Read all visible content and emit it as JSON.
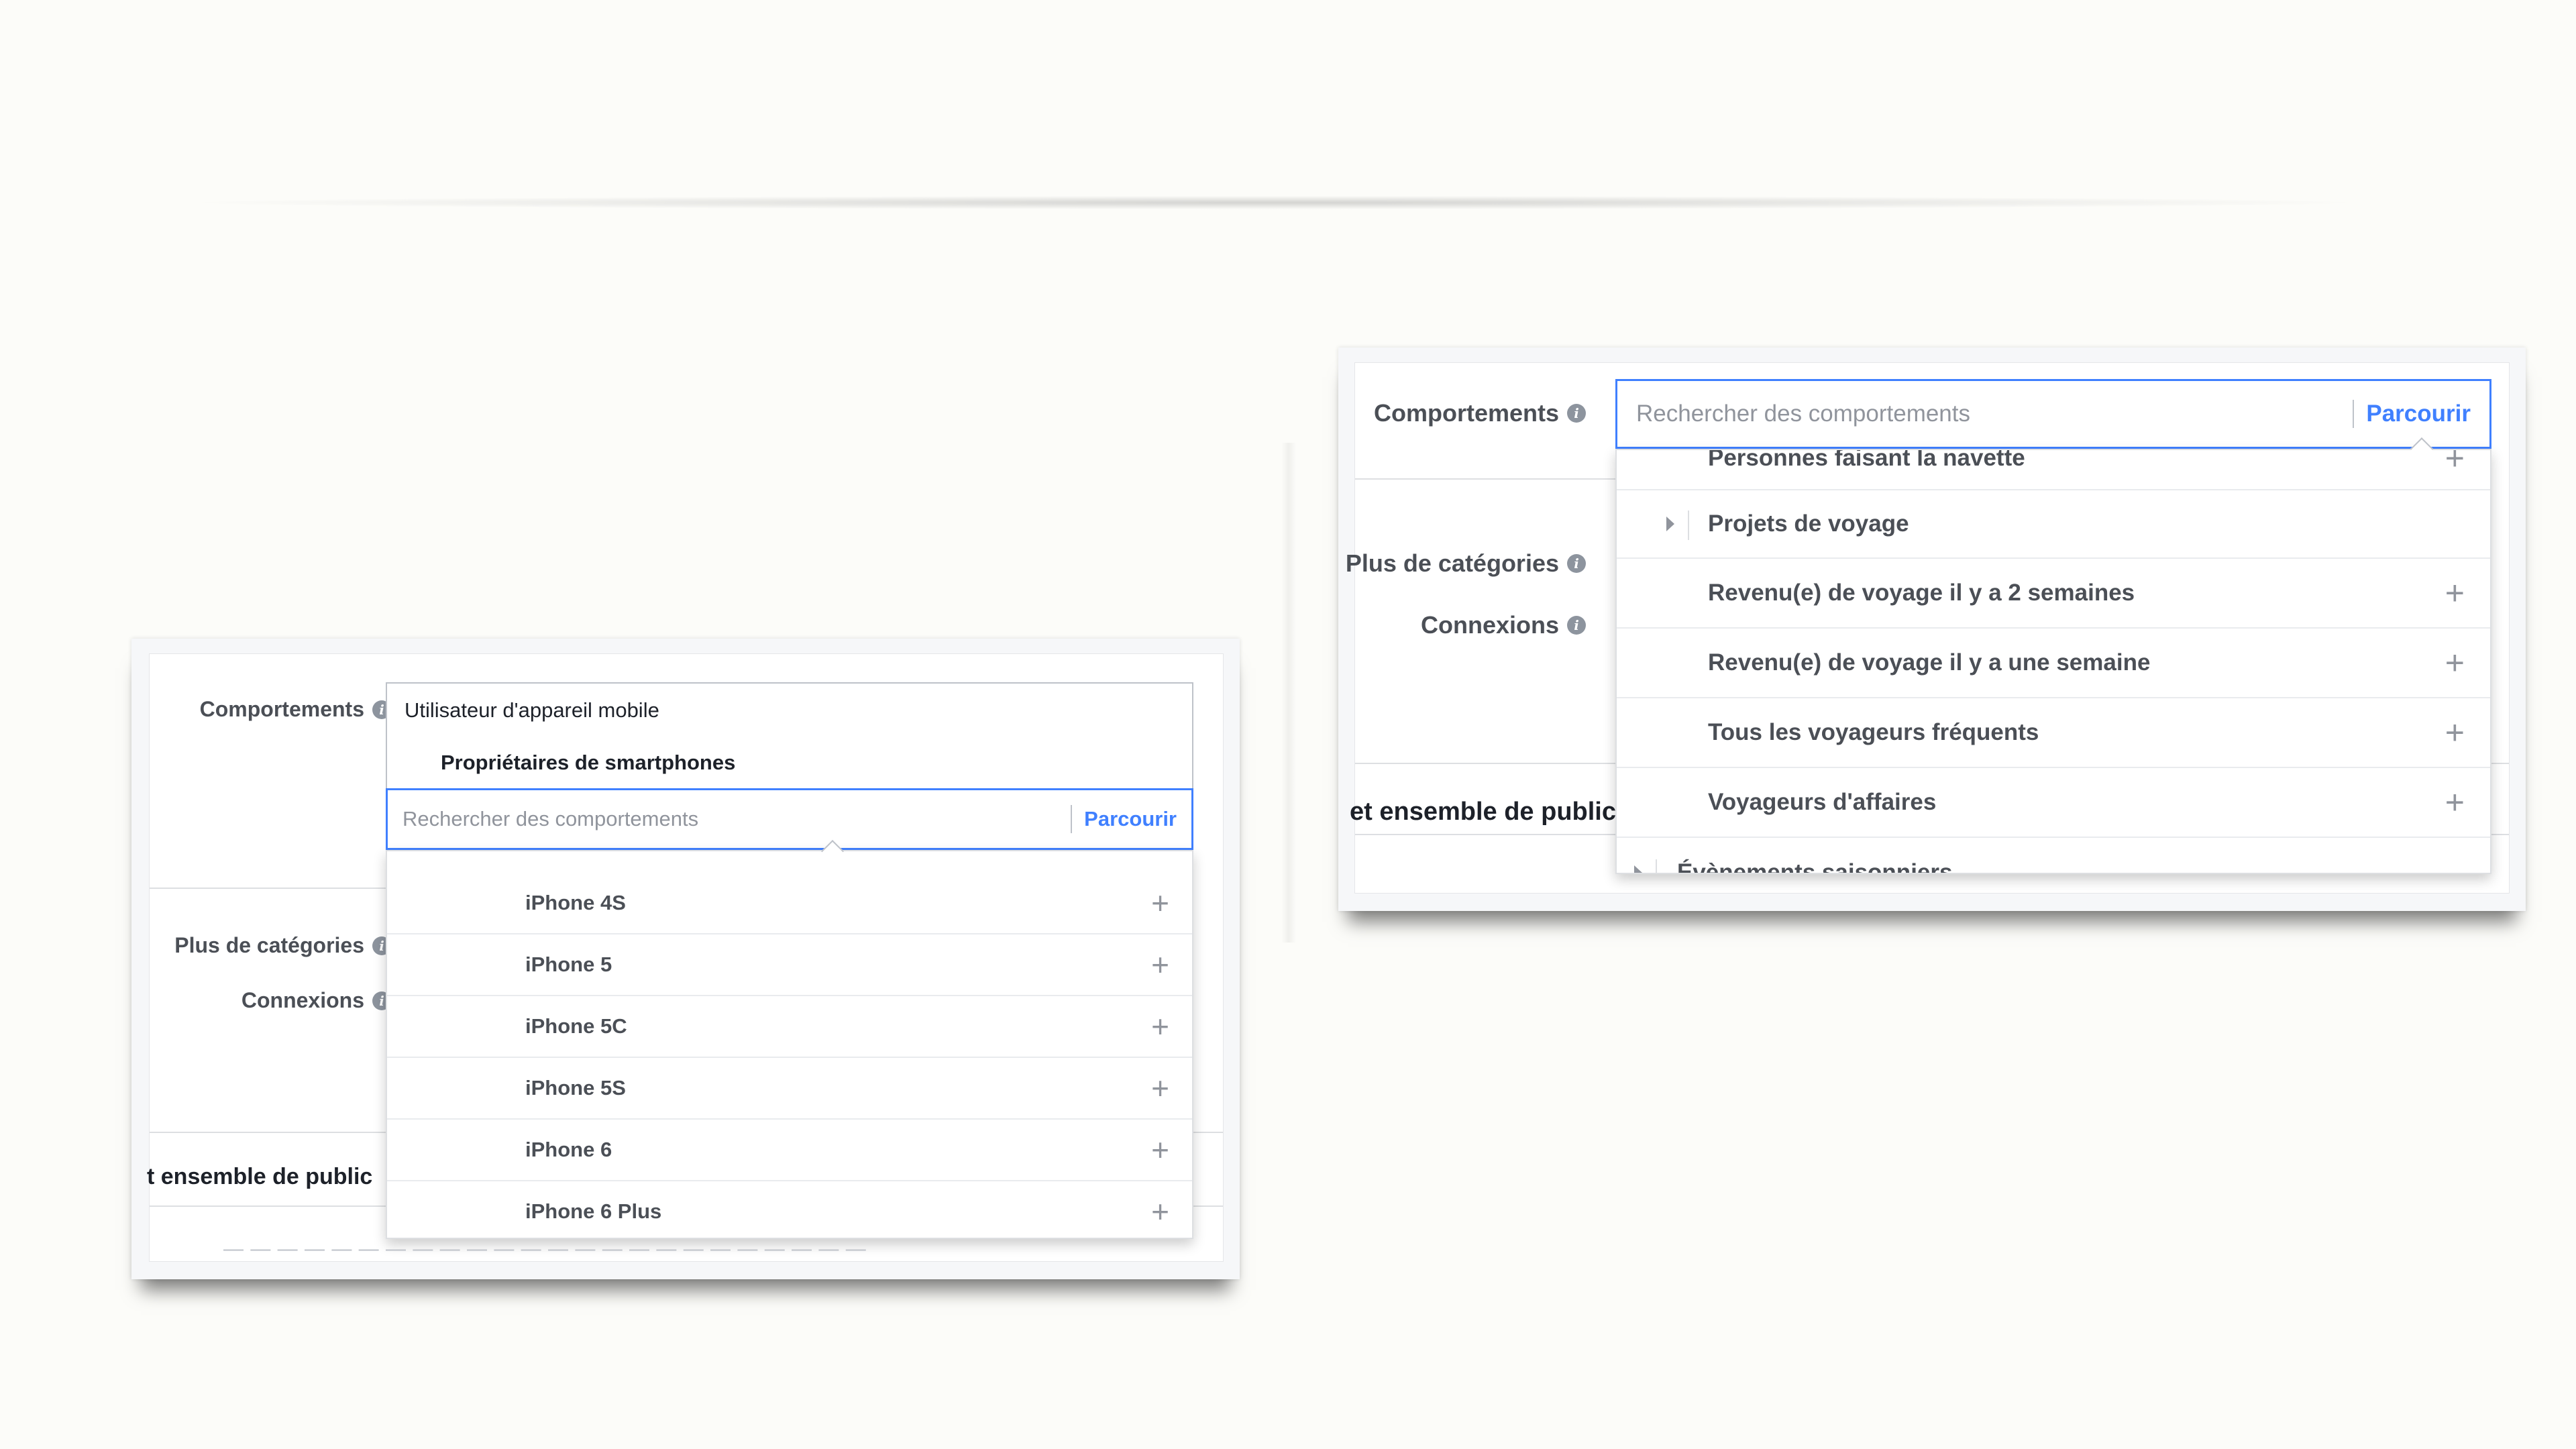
{
  "left_panel": {
    "label_behaviors": "Comportements",
    "label_more_categories": "Plus de catégories",
    "label_connections": "Connexions",
    "label_audience_cut": "t ensemble de public",
    "token_category": "Utilisateur d'appareil mobile",
    "token_selected": "Propriétaires de smartphones",
    "search_placeholder": "Rechercher des comportements",
    "browse_label": "Parcourir",
    "items": [
      {
        "label": "iPhone 4S"
      },
      {
        "label": "iPhone 5"
      },
      {
        "label": "iPhone 5C"
      },
      {
        "label": "iPhone 5S"
      },
      {
        "label": "iPhone 6"
      },
      {
        "label": "iPhone 6 Plus"
      }
    ]
  },
  "right_panel": {
    "label_behaviors": "Comportements",
    "label_more_categories": "Plus de catégories",
    "label_connections": "Connexions",
    "label_audience_cut": "et ensemble de public",
    "search_placeholder": "Rechercher des comportements",
    "browse_label": "Parcourir",
    "cut_item": "Personnes faisant la navette",
    "items": [
      {
        "label": "Projets de voyage",
        "expandable": true
      },
      {
        "label": "Revenu(e) de voyage il y a 2 semaines"
      },
      {
        "label": "Revenu(e) de voyage il y a une semaine"
      },
      {
        "label": "Tous les voyageurs fréquents"
      },
      {
        "label": "Voyageurs d'affaires"
      }
    ],
    "parent_item": "Évènements saisonniers"
  },
  "icons": {
    "info": "info-icon",
    "add": "plus-icon",
    "expand": "triangle-right-icon"
  },
  "colors": {
    "accent": "#4080ff",
    "text": "#4b4f56",
    "muted": "#90949c"
  }
}
